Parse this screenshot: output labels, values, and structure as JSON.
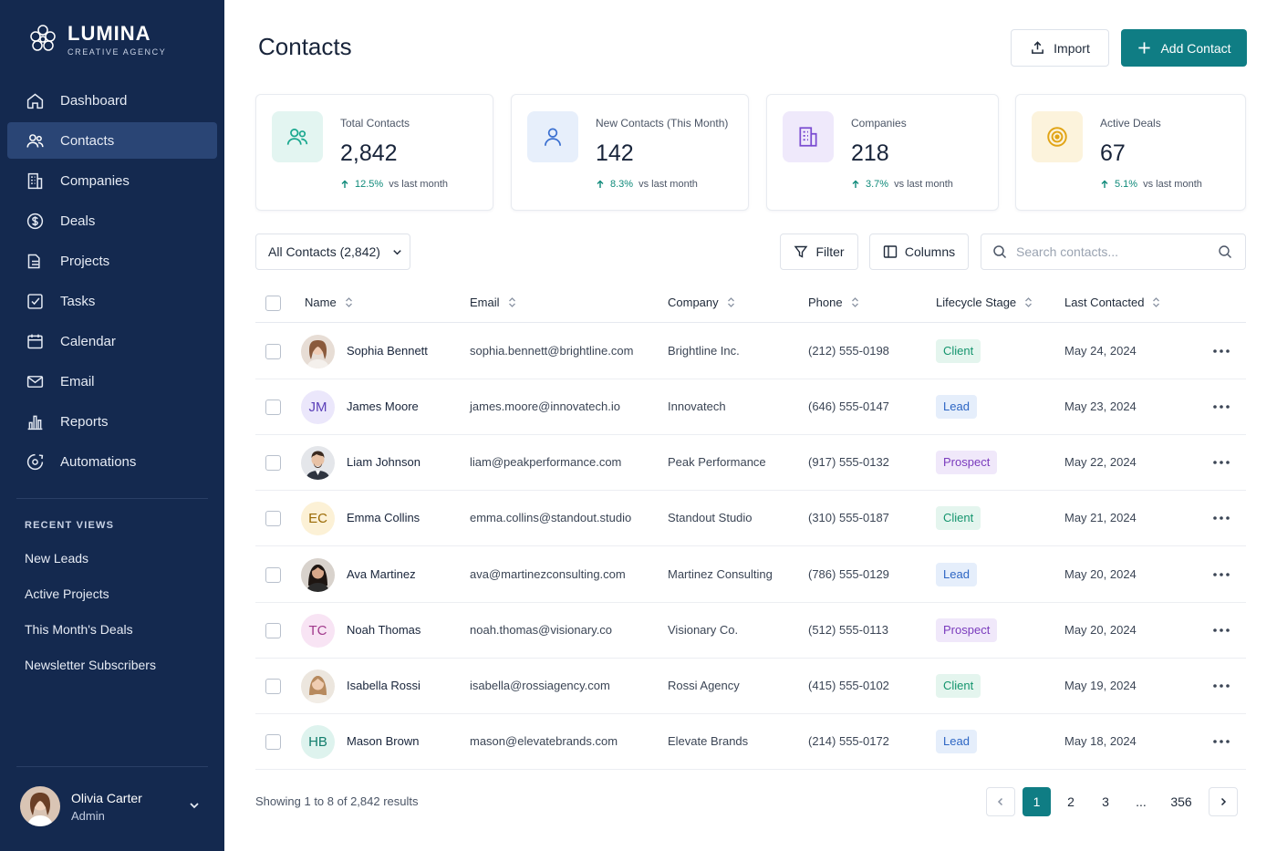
{
  "brand": {
    "name": "LUMINA",
    "tagline": "CREATIVE AGENCY"
  },
  "nav": [
    {
      "label": "Dashboard",
      "icon": "home-icon",
      "active": false
    },
    {
      "label": "Contacts",
      "icon": "users-icon",
      "active": true
    },
    {
      "label": "Companies",
      "icon": "building-icon",
      "active": false
    },
    {
      "label": "Deals",
      "icon": "dollar-circle-icon",
      "active": false
    },
    {
      "label": "Projects",
      "icon": "folder-icon",
      "active": false
    },
    {
      "label": "Tasks",
      "icon": "checkbox-icon",
      "active": false
    },
    {
      "label": "Calendar",
      "icon": "calendar-icon",
      "active": false
    },
    {
      "label": "Email",
      "icon": "mail-icon",
      "active": false
    },
    {
      "label": "Reports",
      "icon": "bar-chart-icon",
      "active": false
    },
    {
      "label": "Automations",
      "icon": "gear-cycle-icon",
      "active": false
    }
  ],
  "recent": {
    "title": "RECENT VIEWS",
    "items": [
      "New Leads",
      "Active Projects",
      "This Month's Deals",
      "Newsletter Subscribers"
    ]
  },
  "user": {
    "name": "Olivia Carter",
    "role": "Admin"
  },
  "page": {
    "title": "Contacts"
  },
  "actions": {
    "import": "Import",
    "add": "Add Contact"
  },
  "stats": [
    {
      "label": "Total Contacts",
      "value": "2,842",
      "delta": "12.5%",
      "suffix": "vs last month",
      "icon": "users-icon",
      "color": "#1aa88f",
      "bg": "#e3f5f1"
    },
    {
      "label": "New Contacts (This Month)",
      "value": "142",
      "delta": "8.3%",
      "suffix": "vs last month",
      "icon": "user-icon",
      "color": "#3a6fd0",
      "bg": "#e7effb"
    },
    {
      "label": "Companies",
      "value": "218",
      "delta": "3.7%",
      "suffix": "vs last month",
      "icon": "building-icon",
      "color": "#7a4bd1",
      "bg": "#efe9fb"
    },
    {
      "label": "Active Deals",
      "value": "67",
      "delta": "5.1%",
      "suffix": "vs last month",
      "icon": "target-icon",
      "color": "#e1a416",
      "bg": "#fcf3dc"
    }
  ],
  "toolbar": {
    "view": "All Contacts (2,842)",
    "filter": "Filter",
    "columns": "Columns",
    "search_placeholder": "Search contacts..."
  },
  "columns": [
    "Name",
    "Email",
    "Company",
    "Phone",
    "Lifecycle Stage",
    "Last Contacted"
  ],
  "rows": [
    {
      "name": "Sophia Bennett",
      "email": "sophia.bennett@brightline.com",
      "company": "Brightline Inc.",
      "phone": "(212) 555-0198",
      "stage": "Client",
      "last": "May 24, 2024",
      "avatar": "photo",
      "initials": ""
    },
    {
      "name": "James Moore",
      "email": "james.moore@innovatech.io",
      "company": "Innovatech",
      "phone": "(646) 555-0147",
      "stage": "Lead",
      "last": "May 23, 2024",
      "avatar": "initials",
      "initials": "JM"
    },
    {
      "name": "Liam Johnson",
      "email": "liam@peakperformance.com",
      "company": "Peak Performance",
      "phone": "(917) 555-0132",
      "stage": "Prospect",
      "last": "May 22, 2024",
      "avatar": "photo",
      "initials": ""
    },
    {
      "name": "Emma Collins",
      "email": "emma.collins@standout.studio",
      "company": "Standout Studio",
      "phone": "(310) 555-0187",
      "stage": "Client",
      "last": "May 21, 2024",
      "avatar": "initials",
      "initials": "EC"
    },
    {
      "name": "Ava Martinez",
      "email": "ava@martinezconsulting.com",
      "company": "Martinez Consulting",
      "phone": "(786) 555-0129",
      "stage": "Lead",
      "last": "May 20, 2024",
      "avatar": "photo",
      "initials": ""
    },
    {
      "name": "Noah Thomas",
      "email": "noah.thomas@visionary.co",
      "company": "Visionary Co.",
      "phone": "(512) 555-0113",
      "stage": "Prospect",
      "last": "May 20, 2024",
      "avatar": "initials",
      "initials": "TC"
    },
    {
      "name": "Isabella Rossi",
      "email": "isabella@rossiagency.com",
      "company": "Rossi Agency",
      "phone": "(415) 555-0102",
      "stage": "Client",
      "last": "May 19, 2024",
      "avatar": "photo",
      "initials": ""
    },
    {
      "name": "Mason Brown",
      "email": "mason@elevatebrands.com",
      "company": "Elevate Brands",
      "phone": "(214) 555-0172",
      "stage": "Lead",
      "last": "May 18, 2024",
      "avatar": "initials",
      "initials": "HB"
    }
  ],
  "footer": {
    "results": "Showing 1 to 8 of 2,842 results",
    "pages": [
      "1",
      "2",
      "3",
      "...",
      "356"
    ],
    "current_page": "1"
  }
}
